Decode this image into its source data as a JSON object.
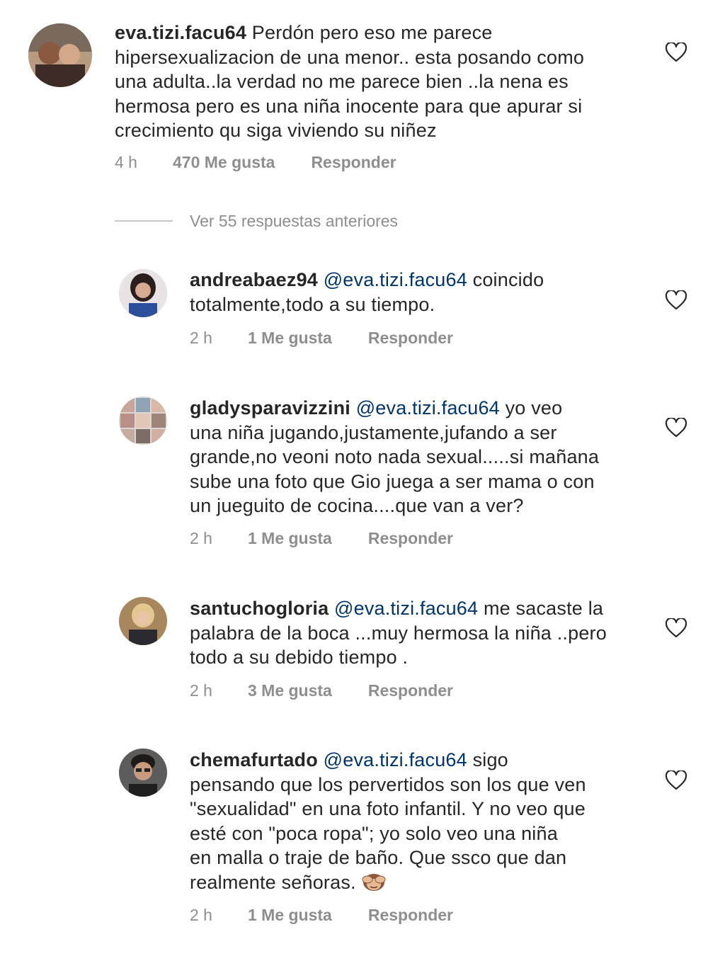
{
  "top_comment": {
    "username": "eva.tizi.facu64",
    "text_lines": [
      "Perdón pero eso me parece",
      "hipersexualizacion de una menor.. esta posando como",
      "una adulta..la verdad no me parece bien ..la nena es",
      "hermosa pero es una niña inocente para que apurar si",
      "crecimiento qu siga viviendo su niñez"
    ],
    "time": "4 h",
    "likes": "470 Me gusta",
    "reply": "Responder"
  },
  "view_replies": "Ver 55 respuestas anteriores",
  "replies": [
    {
      "username": "andreabaez94",
      "mention": "@eva.tizi.facu64",
      "line1_rest": "coincido",
      "lines": [
        "totalmente,todo a su tiempo."
      ],
      "time": "2 h",
      "likes": "1 Me gusta",
      "reply": "Responder"
    },
    {
      "username": "gladysparavizzini",
      "mention": "@eva.tizi.facu64",
      "line1_rest": "yo veo",
      "lines": [
        "una niña jugando,justamente,jufando a ser",
        "grande,no veoni noto nada sexual.....si mañana",
        "sube una foto que Gio juega a ser mama o con",
        "un jueguito de cocina....que van a ver?"
      ],
      "time": "2 h",
      "likes": "1 Me gusta",
      "reply": "Responder"
    },
    {
      "username": "santuchogloria",
      "mention": "@eva.tizi.facu64",
      "line1_rest": "me sacaste la",
      "lines": [
        "palabra de la boca ...muy hermosa la niña ..pero",
        "todo a su debido tiempo ."
      ],
      "time": "2 h",
      "likes": "3 Me gusta",
      "reply": "Responder"
    },
    {
      "username": "chemafurtado",
      "mention": "@eva.tizi.facu64",
      "line1_rest": "sigo",
      "lines": [
        "pensando que los pervertidos son los que ven",
        "\"sexualidad\" en una foto infantil. Y no veo que",
        "esté con \"poca ropa\"; yo solo veo una niña",
        "en malla o traje de baño. Que ssco que dan",
        "realmente señoras."
      ],
      "emoji": "see-no-evil-monkey",
      "time": "2 h",
      "likes": "1 Me gusta",
      "reply": "Responder"
    }
  ],
  "colors": {
    "text": "#262626",
    "mention": "#003569",
    "meta": "#8e8e8e",
    "heart": "#262626"
  }
}
